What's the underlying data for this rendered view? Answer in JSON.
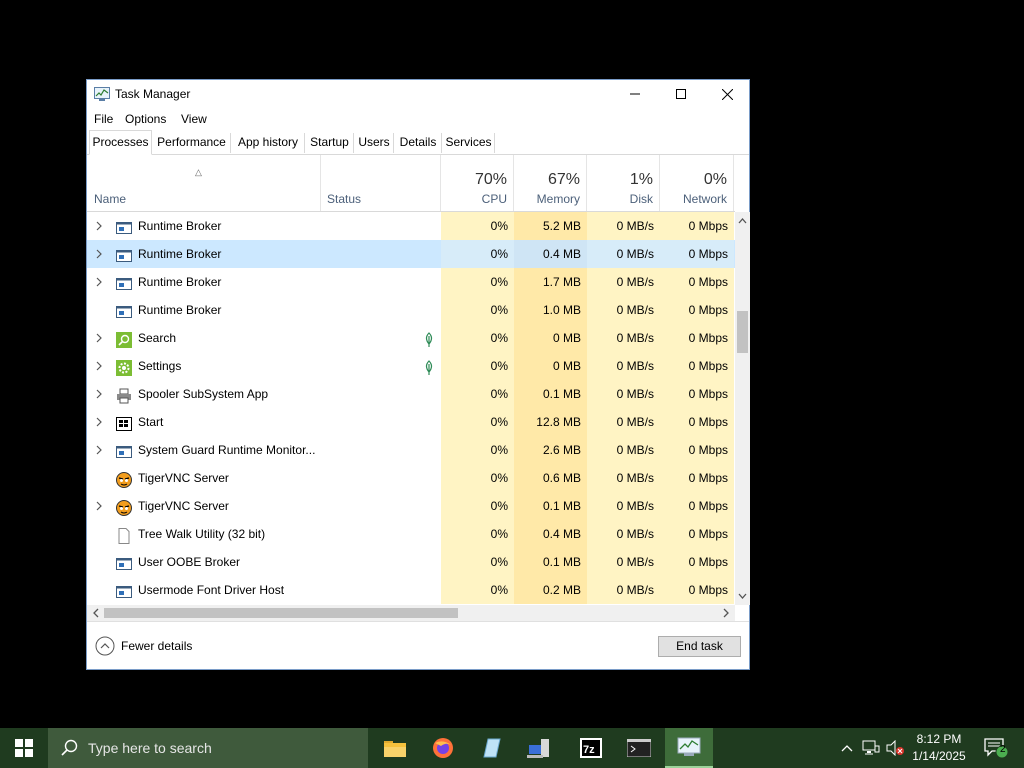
{
  "window": {
    "title": "Task Manager",
    "menu": [
      "File",
      "Options",
      "View"
    ],
    "tabs": [
      "Processes",
      "Performance",
      "App history",
      "Startup",
      "Users",
      "Details",
      "Services"
    ],
    "active_tab": "Processes"
  },
  "columns": {
    "name": "Name",
    "status": "Status",
    "cpu": {
      "pct": "70%",
      "label": "CPU"
    },
    "memory": {
      "pct": "67%",
      "label": "Memory"
    },
    "disk": {
      "pct": "1%",
      "label": "Disk"
    },
    "network": {
      "pct": "0%",
      "label": "Network"
    }
  },
  "processes": [
    {
      "name": "Runtime Broker",
      "expand": true,
      "icon": "app-window-icon",
      "cpu": "0%",
      "memory": "5.2 MB",
      "disk": "0 MB/s",
      "network": "0 Mbps"
    },
    {
      "name": "Runtime Broker",
      "expand": true,
      "icon": "app-window-icon",
      "cpu": "0%",
      "memory": "0.4 MB",
      "disk": "0 MB/s",
      "network": "0 Mbps",
      "selected": true
    },
    {
      "name": "Runtime Broker",
      "expand": true,
      "icon": "app-window-icon",
      "cpu": "0%",
      "memory": "1.7 MB",
      "disk": "0 MB/s",
      "network": "0 Mbps"
    },
    {
      "name": "Runtime Broker",
      "expand": false,
      "icon": "app-window-icon",
      "cpu": "0%",
      "memory": "1.0 MB",
      "disk": "0 MB/s",
      "network": "0 Mbps"
    },
    {
      "name": "Search",
      "expand": true,
      "icon": "search-app-icon",
      "suspended": true,
      "cpu": "0%",
      "memory": "0 MB",
      "disk": "0 MB/s",
      "network": "0 Mbps"
    },
    {
      "name": "Settings",
      "expand": true,
      "icon": "settings-gear-icon",
      "suspended": true,
      "cpu": "0%",
      "memory": "0 MB",
      "disk": "0 MB/s",
      "network": "0 Mbps"
    },
    {
      "name": "Spooler SubSystem App",
      "expand": true,
      "icon": "printer-icon",
      "cpu": "0%",
      "memory": "0.1 MB",
      "disk": "0 MB/s",
      "network": "0 Mbps"
    },
    {
      "name": "Start",
      "expand": true,
      "icon": "start-icon",
      "cpu": "0%",
      "memory": "12.8 MB",
      "disk": "0 MB/s",
      "network": "0 Mbps"
    },
    {
      "name": "System Guard Runtime Monitor...",
      "expand": true,
      "icon": "app-window-icon",
      "cpu": "0%",
      "memory": "2.6 MB",
      "disk": "0 MB/s",
      "network": "0 Mbps"
    },
    {
      "name": "TigerVNC Server",
      "expand": false,
      "icon": "tigervnc-icon",
      "cpu": "0%",
      "memory": "0.6 MB",
      "disk": "0 MB/s",
      "network": "0 Mbps"
    },
    {
      "name": "TigerVNC Server",
      "expand": true,
      "icon": "tigervnc-icon",
      "cpu": "0%",
      "memory": "0.1 MB",
      "disk": "0 MB/s",
      "network": "0 Mbps"
    },
    {
      "name": "Tree Walk Utility (32 bit)",
      "expand": false,
      "icon": "document-icon",
      "cpu": "0%",
      "memory": "0.4 MB",
      "disk": "0 MB/s",
      "network": "0 Mbps"
    },
    {
      "name": "User OOBE Broker",
      "expand": false,
      "icon": "app-window-icon",
      "cpu": "0%",
      "memory": "0.1 MB",
      "disk": "0 MB/s",
      "network": "0 Mbps"
    },
    {
      "name": "Usermode Font Driver Host",
      "expand": false,
      "icon": "app-window-icon",
      "cpu": "0%",
      "memory": "0.2 MB",
      "disk": "0 MB/s",
      "network": "0 Mbps"
    }
  ],
  "footer": {
    "fewer_details": "Fewer details",
    "end_task": "End task"
  },
  "taskbar": {
    "search_placeholder": "Type here to search",
    "time": "8:12 PM",
    "date": "1/14/2025",
    "notification_count": "2"
  }
}
